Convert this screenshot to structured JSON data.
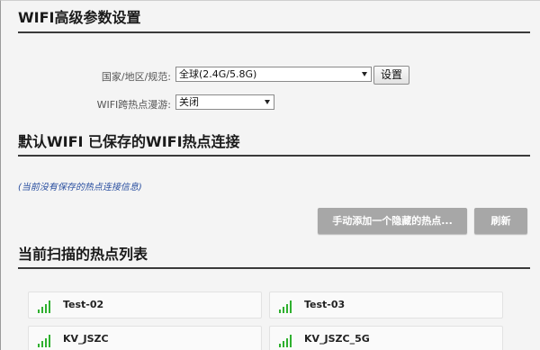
{
  "page_title": "WIFI高级参数设置",
  "region": {
    "label": "国家/地区/规范:",
    "selected": "全球(2.4G/5.8G)",
    "set_button": "设置"
  },
  "roaming": {
    "label": "WIFI跨热点漫游:",
    "selected": "关闭"
  },
  "saved_section": {
    "title": "默认WIFI 已保存的WIFI热点连接",
    "empty_note": "(当前没有保存的热点连接信息)",
    "add_hidden_button": "手动添加一个隐藏的热点...",
    "refresh_button": "刷新"
  },
  "scan_section": {
    "title": "当前扫描的热点列表",
    "hotspots": [
      {
        "ssid": "Test-02",
        "signal_icon": "wifi-signal-full-icon"
      },
      {
        "ssid": "Test-03",
        "signal_icon": "wifi-signal-full-icon"
      },
      {
        "ssid": "KV_JSZC",
        "signal_icon": "wifi-signal-full-icon"
      },
      {
        "ssid": "KV_JSZC_5G",
        "signal_icon": "wifi-signal-full-icon"
      }
    ]
  },
  "colors": {
    "signal_green": "#2fb02f",
    "button_gray": "#a7a7a7",
    "note_blue": "#2a4fa0"
  }
}
